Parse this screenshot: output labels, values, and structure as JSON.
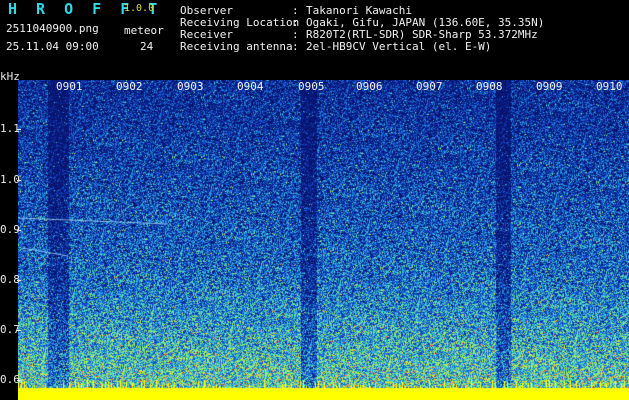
{
  "header": {
    "app_title": "H R O F F T",
    "version": "1.0.0",
    "file_name": "2511040900.png",
    "datetime": "25.11.04 09:00",
    "meteor_label": "meteor",
    "meteor_count": "24",
    "info": [
      {
        "label": "Observer",
        "value": "Takanori Kawachi"
      },
      {
        "label": "Receiving Location",
        "value": "Ogaki, Gifu, JAPAN (136.60E, 35.35N)"
      },
      {
        "label": "Receiver",
        "value": "R820T2(RTL-SDR) SDR-Sharp 53.372MHz"
      },
      {
        "label": "Receiving antenna",
        "value": "2el-HB9CV Vertical (el. E-W)"
      }
    ],
    "separator": ":"
  },
  "axis": {
    "unit": "kHz",
    "y_labels": [
      "1.1",
      "1.0",
      "0.9",
      "0.8",
      "0.7",
      "0.6"
    ],
    "x_labels": [
      "0901",
      "0902",
      "0903",
      "0904",
      "0905",
      "0906",
      "0907",
      "0908",
      "0909",
      "0910"
    ]
  },
  "colors": {
    "background": "#000000",
    "title": "#2fd9e6",
    "version": "#dddd33",
    "text": "#f0f0f0",
    "spectrum_low": "#0a1a7a",
    "spectrum_mid": "#2a8fd0",
    "spectrum_high": "#7ff0a0",
    "spectrum_peak": "#ff3030",
    "baseline": "#ffff00"
  }
}
